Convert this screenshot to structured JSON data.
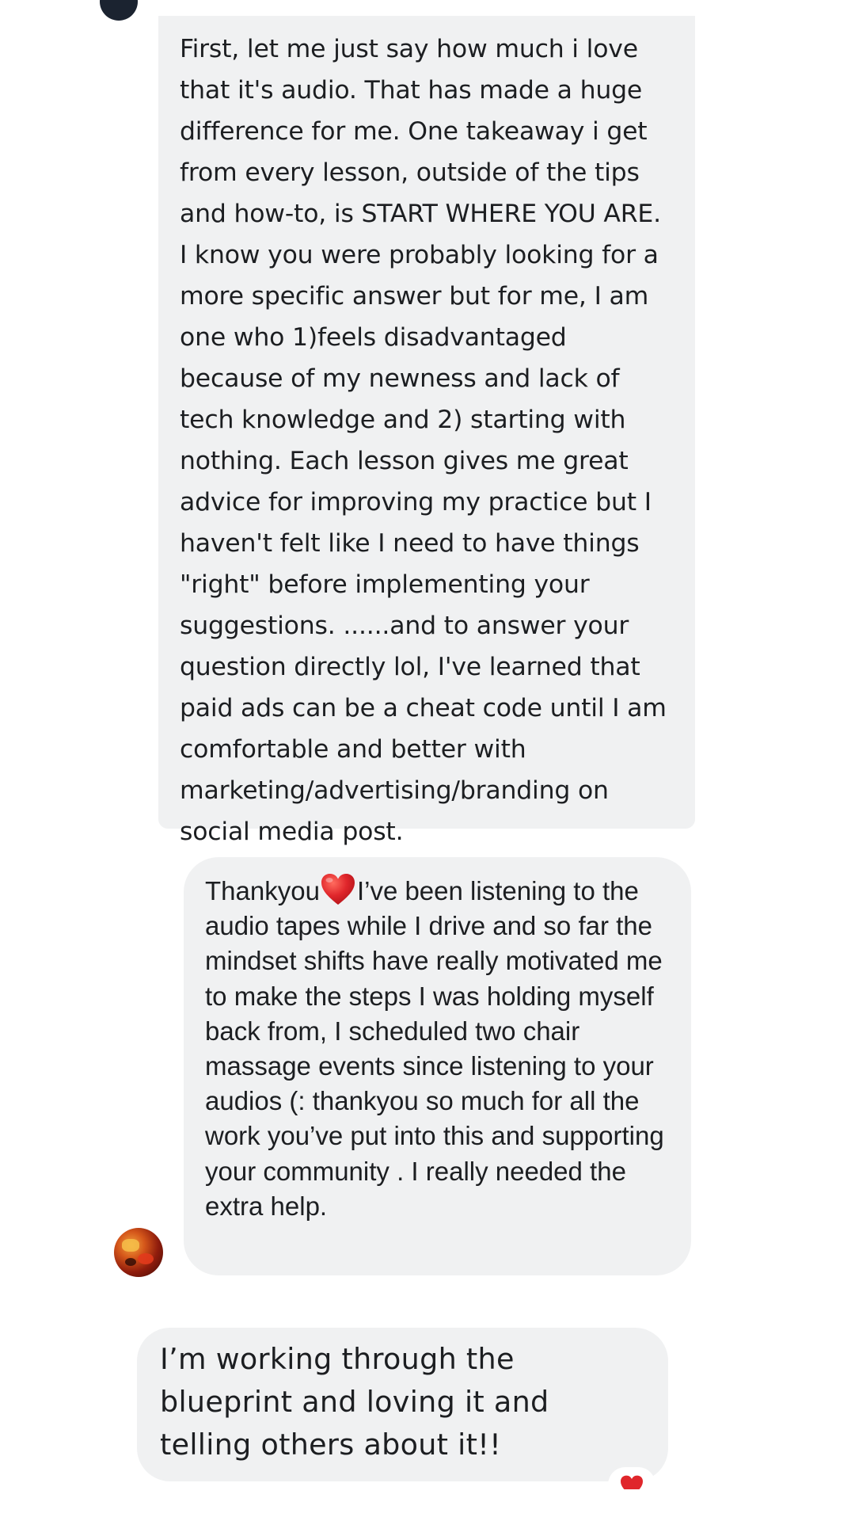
{
  "messages": [
    {
      "text": "First, let me just say how much i love that it's audio. That has made a huge difference for me. One takeaway i get from every lesson, outside of the tips and how-to, is START WHERE YOU ARE. I know you were probably looking for a more specific answer but for me, I am one who 1)feels disadvantaged because of my newness and lack of tech knowledge and 2) starting with nothing. Each lesson gives me great advice for improving my practice but I haven't felt like I need to have things \"right\" before implementing your suggestions. ......and to answer your question directly lol, I've learned that paid ads can be a cheat code until I am comfortable and better with marketing/advertising/branding on social media post."
    },
    {
      "text_before_emoji": "Thankyou",
      "emoji": "red-heart",
      "text_after_emoji": "I’ve been listening to the audio tapes while I drive and so far the mindset shifts have really motivated me to make the steps I was holding myself back from, I scheduled two chair massage events since listening to your audios (: thankyou so much for all the work you’ve put into this and supporting your community . I really needed the extra help."
    },
    {
      "text": "I’m working through the blueprint and loving it and telling others about it!!",
      "reaction": "red-heart"
    }
  ],
  "colors": {
    "bubble": "#f0f1f2",
    "text": "#1c1e21",
    "heart": "#e0262b"
  }
}
